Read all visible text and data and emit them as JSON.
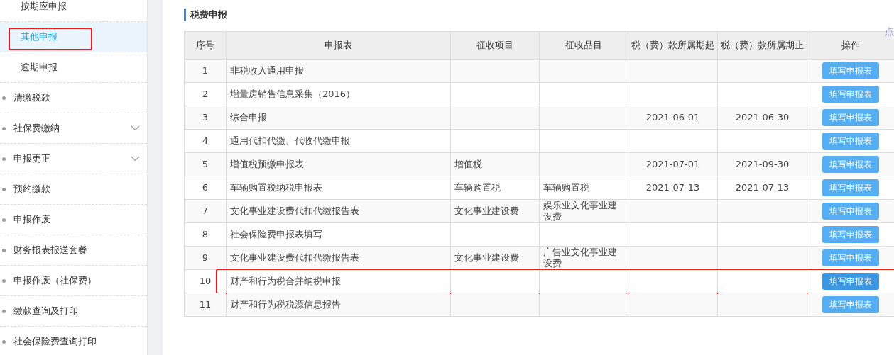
{
  "sidebar": {
    "items": [
      {
        "label": "按期应申报",
        "kind": "sub",
        "selected": false,
        "highlighted": false
      },
      {
        "label": "其他申报",
        "kind": "sub",
        "selected": true,
        "highlighted": true
      },
      {
        "label": "逾期申报",
        "kind": "sub",
        "selected": false,
        "highlighted": false
      },
      {
        "label": "清缴税款",
        "kind": "main",
        "selected": false,
        "expandable": false,
        "highlighted": false
      },
      {
        "label": "社保费缴纳",
        "kind": "main",
        "selected": false,
        "expandable": true,
        "highlighted": false
      },
      {
        "label": "申报更正",
        "kind": "main",
        "selected": false,
        "expandable": true,
        "highlighted": false
      },
      {
        "label": "预约缴款",
        "kind": "main",
        "selected": false,
        "expandable": false,
        "highlighted": false
      },
      {
        "label": "申报作废",
        "kind": "main",
        "selected": false,
        "expandable": false,
        "highlighted": false
      },
      {
        "label": "财务报表报送套餐",
        "kind": "main",
        "selected": false,
        "expandable": false,
        "highlighted": false
      },
      {
        "label": "申报作废（社保费）",
        "kind": "main",
        "selected": false,
        "expandable": false,
        "highlighted": false
      },
      {
        "label": "缴款查询及打印",
        "kind": "main",
        "selected": false,
        "expandable": false,
        "highlighted": false
      },
      {
        "label": "社会保险费查询打印",
        "kind": "main",
        "selected": false,
        "expandable": false,
        "highlighted": false
      }
    ]
  },
  "corner_text": "点",
  "section_title": "税费申报",
  "table": {
    "columns": [
      "序号",
      "申报表",
      "征收项目",
      "征收品目",
      "税（费）款所属期起",
      "税（费）款所属期止",
      "操作"
    ],
    "rows": [
      {
        "cells": [
          "1",
          "非税收入通用申报",
          "",
          "",
          "",
          ""
        ],
        "action": "填写申报表",
        "highlighted": false
      },
      {
        "cells": [
          "2",
          "增量房销售信息采集（2016）",
          "",
          "",
          "",
          ""
        ],
        "action": "填写申报表",
        "highlighted": false
      },
      {
        "cells": [
          "3",
          "综合申报",
          "",
          "",
          "2021-06-01",
          "2021-06-30"
        ],
        "action": "填写申报表",
        "highlighted": false
      },
      {
        "cells": [
          "4",
          "通用代扣代缴、代收代缴申报",
          "",
          "",
          "",
          ""
        ],
        "action": "填写申报表",
        "highlighted": false
      },
      {
        "cells": [
          "5",
          "增值税预缴申报表",
          "增值税",
          "",
          "2021-07-01",
          "2021-09-30"
        ],
        "action": "填写申报表",
        "highlighted": false
      },
      {
        "cells": [
          "6",
          "车辆购置税纳税申报表",
          "车辆购置税",
          "车辆购置税",
          "2021-07-13",
          "2021-07-13"
        ],
        "action": "填写申报表",
        "highlighted": false
      },
      {
        "cells": [
          "7",
          "文化事业建设费代扣代缴报告表",
          "文化事业建设费",
          "娱乐业文化事业建设费",
          "",
          ""
        ],
        "action": "填写申报表",
        "highlighted": false
      },
      {
        "cells": [
          "8",
          "社会保险费申报表填写",
          "",
          "",
          "",
          ""
        ],
        "action": "填写申报表",
        "highlighted": false
      },
      {
        "cells": [
          "9",
          "文化事业建设费代扣代缴报告表",
          "文化事业建设费",
          "广告业文化事业建设费",
          "",
          ""
        ],
        "action": "填写申报表",
        "highlighted": false
      },
      {
        "cells": [
          "10",
          "财产和行为税合并纳税申报",
          "",
          "",
          "",
          ""
        ],
        "action": "填写申报表",
        "highlighted": true
      },
      {
        "cells": [
          "11",
          "财产和行为税税源信息报告",
          "",
          "",
          "",
          ""
        ],
        "action": "填写申报表",
        "highlighted": false
      }
    ]
  }
}
